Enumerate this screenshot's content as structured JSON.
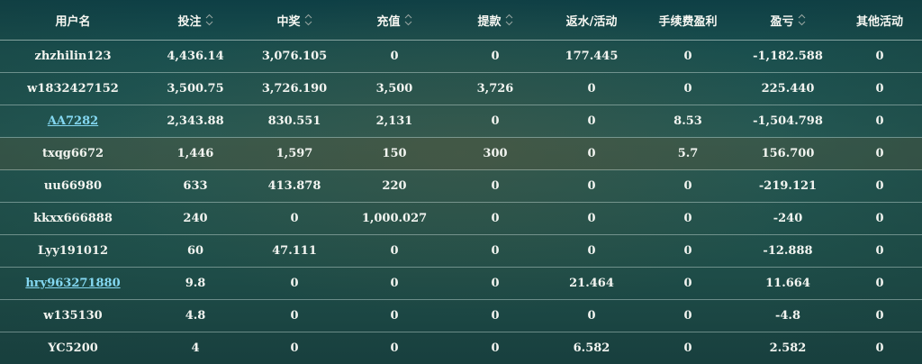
{
  "table": {
    "headers": [
      {
        "label": "用户名",
        "sortable": false
      },
      {
        "label": "投注",
        "sortable": true
      },
      {
        "label": "中奖",
        "sortable": true
      },
      {
        "label": "充值",
        "sortable": true
      },
      {
        "label": "提款",
        "sortable": true
      },
      {
        "label": "返水/活动",
        "sortable": false
      },
      {
        "label": "手续费盈利",
        "sortable": false
      },
      {
        "label": "盈亏",
        "sortable": true
      },
      {
        "label": "其他活动",
        "sortable": false
      }
    ],
    "rows": [
      {
        "username": "zhzhilin123",
        "link": false,
        "bet": "4,436.14",
        "win": "3,076.105",
        "deposit": "0",
        "withdraw": "0",
        "rebate": "177.445",
        "fee_profit": "0",
        "profit": "-1,182.588",
        "other": "0"
      },
      {
        "username": "w1832427152",
        "link": false,
        "bet": "3,500.75",
        "win": "3,726.190",
        "deposit": "3,500",
        "withdraw": "3,726",
        "rebate": "0",
        "fee_profit": "0",
        "profit": "225.440",
        "other": "0"
      },
      {
        "username": "AA7282",
        "link": true,
        "bet": "2,343.88",
        "win": "830.551",
        "deposit": "2,131",
        "withdraw": "0",
        "rebate": "0",
        "fee_profit": "8.53",
        "profit": "-1,504.798",
        "other": "0"
      },
      {
        "username": "txqg6672",
        "link": false,
        "highlight": true,
        "bet": "1,446",
        "win": "1,597",
        "deposit": "150",
        "withdraw": "300",
        "rebate": "0",
        "fee_profit": "5.7",
        "profit": "156.700",
        "other": "0"
      },
      {
        "username": "uu66980",
        "link": false,
        "bet": "633",
        "win": "413.878",
        "deposit": "220",
        "withdraw": "0",
        "rebate": "0",
        "fee_profit": "0",
        "profit": "-219.121",
        "other": "0"
      },
      {
        "username": "kkxx666888",
        "link": false,
        "bet": "240",
        "win": "0",
        "deposit": "1,000.027",
        "withdraw": "0",
        "rebate": "0",
        "fee_profit": "0",
        "profit": "-240",
        "other": "0"
      },
      {
        "username": "Lyy191012",
        "link": false,
        "bet": "60",
        "win": "47.111",
        "deposit": "0",
        "withdraw": "0",
        "rebate": "0",
        "fee_profit": "0",
        "profit": "-12.888",
        "other": "0"
      },
      {
        "username": "hry963271880",
        "link": true,
        "bet": "9.8",
        "win": "0",
        "deposit": "0",
        "withdraw": "0",
        "rebate": "21.464",
        "fee_profit": "0",
        "profit": "11.664",
        "other": "0"
      },
      {
        "username": "w135130",
        "link": false,
        "bet": "4.8",
        "win": "0",
        "deposit": "0",
        "withdraw": "0",
        "rebate": "0",
        "fee_profit": "0",
        "profit": "-4.8",
        "other": "0"
      },
      {
        "username": "YC5200",
        "link": false,
        "bet": "4",
        "win": "0",
        "deposit": "0",
        "withdraw": "0",
        "rebate": "6.582",
        "fee_profit": "0",
        "profit": "2.582",
        "other": "0"
      }
    ]
  },
  "colors": {
    "link": "#84d8f2",
    "text": "#f3f5f1",
    "border": "#dcebe6",
    "bg": "#173f3c"
  },
  "icons": {
    "sort": "sort-updown-icon"
  }
}
